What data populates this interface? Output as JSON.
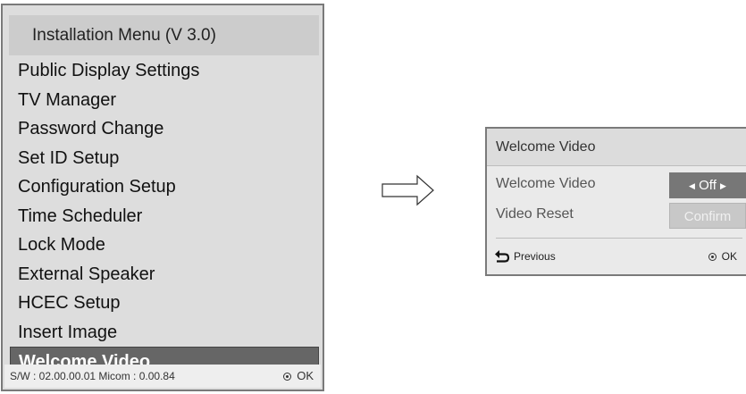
{
  "installation_menu": {
    "title": "Installation Menu (V 3.0)",
    "items": [
      {
        "label": "Public Display Settings"
      },
      {
        "label": "TV Manager"
      },
      {
        "label": "Password Change"
      },
      {
        "label": "Set ID Setup"
      },
      {
        "label": "Configuration Setup"
      },
      {
        "label": "Time Scheduler"
      },
      {
        "label": "Lock Mode"
      },
      {
        "label": "External Speaker"
      },
      {
        "label": "HCEC Setup"
      },
      {
        "label": "Insert Image"
      },
      {
        "label": "Welcome Video",
        "selected": true
      }
    ],
    "footer": {
      "version": "S/W : 02.00.00.01 Micom : 0.00.84",
      "ok_label": "OK",
      "ok_icon": "ok-button-icon"
    }
  },
  "arrow_icon": "right-arrow-icon",
  "welcome_video_dialog": {
    "title": "Welcome Video",
    "rows": [
      {
        "label": "Welcome Video",
        "value": "Off",
        "state": "active"
      },
      {
        "label": "Video Reset",
        "value": "Confirm",
        "state": "inactive"
      }
    ],
    "footer": {
      "previous_label": "Previous",
      "previous_icon": "back-arrow-icon",
      "ok_label": "OK",
      "ok_icon": "ok-button-icon"
    }
  },
  "colors": {
    "selected_item_bg": "#666666",
    "menu_bg": "#dddddd",
    "active_control_bg": "#777777",
    "inactive_control_bg": "#c8c8c8"
  }
}
